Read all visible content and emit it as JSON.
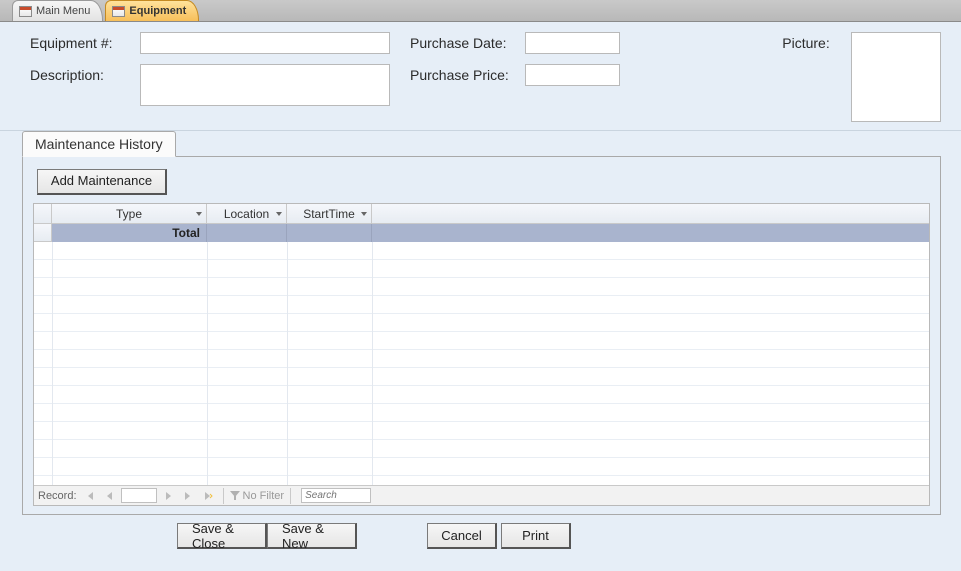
{
  "tabs": {
    "main_menu": "Main Menu",
    "equipment": "Equipment"
  },
  "form": {
    "equipment_no_label": "Equipment #:",
    "equipment_no_value": "",
    "description_label": "Description:",
    "description_value": "",
    "purchase_date_label": "Purchase Date:",
    "purchase_date_value": "",
    "purchase_price_label": "Purchase Price:",
    "purchase_price_value": "",
    "picture_label": "Picture:"
  },
  "tabcontrol": {
    "history_label": "Maintenance History",
    "add_button": "Add Maintenance",
    "columns": {
      "type": "Type",
      "location": "Location",
      "starttime": "StartTime"
    },
    "total_label": "Total"
  },
  "recordnav": {
    "label": "Record:",
    "current": "",
    "nofilter": "No Filter",
    "search_placeholder": "Search"
  },
  "buttons": {
    "save_close": "Save & Close",
    "save_new": "Save & New",
    "cancel": "Cancel",
    "print": "Print"
  }
}
